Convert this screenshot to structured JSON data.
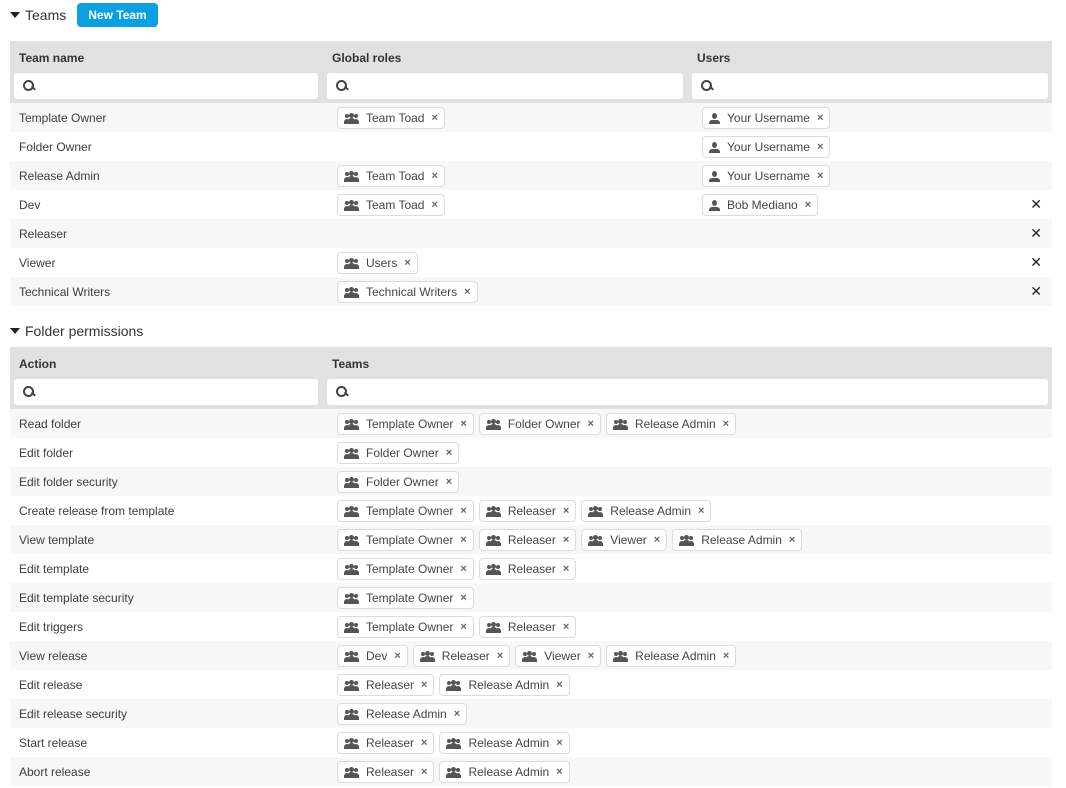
{
  "teams_section": {
    "title": "Teams",
    "new_team_label": "New Team",
    "columns": [
      "Team name",
      "Global roles",
      "Users"
    ],
    "search_placeholders": [
      "",
      "",
      ""
    ],
    "rows": [
      {
        "name": "Template Owner",
        "roles": [
          "Team Toad"
        ],
        "users": [
          "Your Username"
        ],
        "deletable": false
      },
      {
        "name": "Folder Owner",
        "roles": [],
        "users": [
          "Your Username"
        ],
        "deletable": false
      },
      {
        "name": "Release Admin",
        "roles": [
          "Team Toad"
        ],
        "users": [
          "Your Username"
        ],
        "deletable": false
      },
      {
        "name": "Dev",
        "roles": [
          "Team Toad"
        ],
        "users": [
          "Bob Mediano"
        ],
        "deletable": true
      },
      {
        "name": "Releaser",
        "roles": [],
        "users": [],
        "deletable": true
      },
      {
        "name": "Viewer",
        "roles": [
          "Users"
        ],
        "users": [],
        "deletable": true
      },
      {
        "name": "Technical Writers",
        "roles": [
          "Technical Writers"
        ],
        "users": [],
        "deletable": true
      }
    ]
  },
  "folder_permissions": {
    "title": "Folder permissions",
    "columns": [
      "Action",
      "Teams"
    ],
    "search_placeholders": [
      "",
      ""
    ],
    "rows": [
      {
        "action": "Read folder",
        "teams": [
          "Template Owner",
          "Folder Owner",
          "Release Admin"
        ]
      },
      {
        "action": "Edit folder",
        "teams": [
          "Folder Owner"
        ]
      },
      {
        "action": "Edit folder security",
        "teams": [
          "Folder Owner"
        ]
      },
      {
        "action": "Create release from template",
        "teams": [
          "Template Owner",
          "Releaser",
          "Release Admin"
        ]
      },
      {
        "action": "View template",
        "teams": [
          "Template Owner",
          "Releaser",
          "Viewer",
          "Release Admin"
        ]
      },
      {
        "action": "Edit template",
        "teams": [
          "Template Owner",
          "Releaser"
        ]
      },
      {
        "action": "Edit template security",
        "teams": [
          "Template Owner"
        ]
      },
      {
        "action": "Edit triggers",
        "teams": [
          "Template Owner",
          "Releaser"
        ]
      },
      {
        "action": "View release",
        "teams": [
          "Dev",
          "Releaser",
          "Viewer",
          "Release Admin"
        ]
      },
      {
        "action": "Edit release",
        "teams": [
          "Releaser",
          "Release Admin"
        ]
      },
      {
        "action": "Edit release security",
        "teams": [
          "Release Admin"
        ]
      },
      {
        "action": "Start release",
        "teams": [
          "Releaser",
          "Release Admin"
        ]
      },
      {
        "action": "Abort release",
        "teams": [
          "Releaser",
          "Release Admin"
        ]
      }
    ]
  },
  "icons": {
    "chip_remove": "×",
    "row_delete": "✕",
    "role_chip_icon": "group-icon",
    "user_chip_icon": "user-icon",
    "search": "search-icon",
    "section_toggle": "caret-down-icon"
  },
  "colors": {
    "primary_button": "#0da0e0",
    "table_header": "#e1e1e1",
    "row_alt": "#f7f7f7"
  }
}
